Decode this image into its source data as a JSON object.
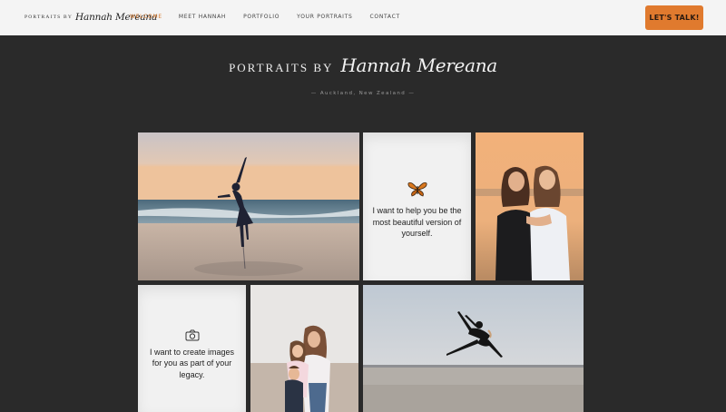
{
  "header": {
    "logo_prefix": "PORTRAITS BY",
    "logo_script": "Hannah Mereana",
    "nav": [
      {
        "label": "WELCOME",
        "active": true
      },
      {
        "label": "MEET HANNAH",
        "active": false
      },
      {
        "label": "PORTFOLIO",
        "active": false
      },
      {
        "label": "YOUR PORTRAITS",
        "active": false
      },
      {
        "label": "CONTACT",
        "active": false
      }
    ],
    "cta_label": "LET'S TALK!"
  },
  "hero": {
    "prefix": "PORTRAITS BY",
    "script": "Hannah Mereana",
    "location": "— Auckland, New Zealand —"
  },
  "cards": {
    "help_text": "I want to help you be the most beautiful version of yourself.",
    "help_icon": "butterfly-icon",
    "legacy_text": "I want to create images for you as part of your legacy.",
    "legacy_icon": "camera-icon"
  },
  "colors": {
    "accent": "#e07a2e",
    "active_nav": "#d97a2c",
    "background": "#2a2a2a",
    "header_bg": "#f4f4f4",
    "card_bg": "#f1f1f1"
  }
}
